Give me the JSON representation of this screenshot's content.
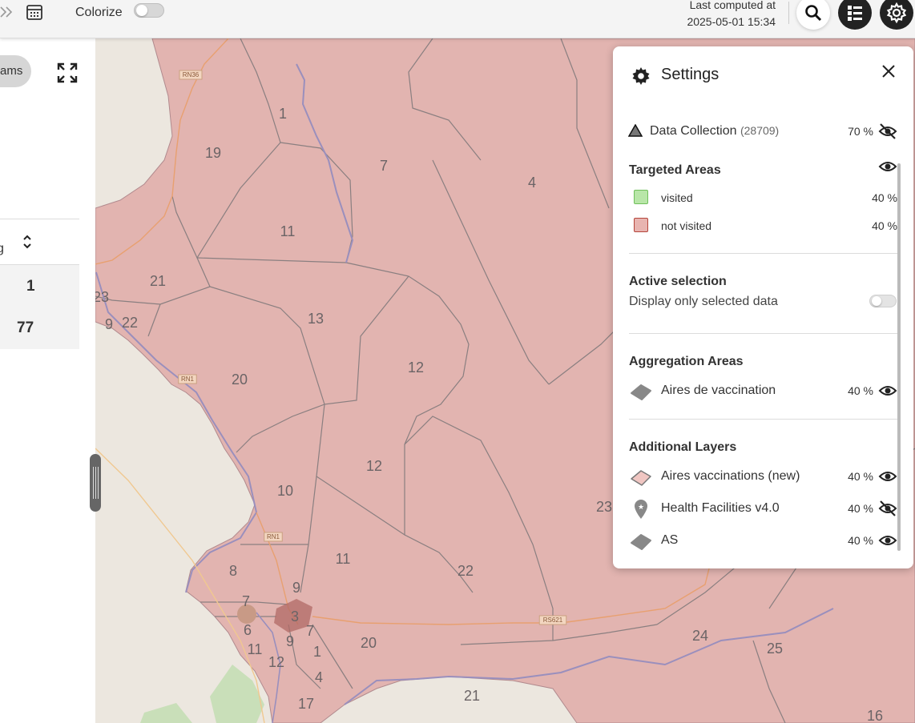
{
  "topbar": {
    "colorize_label": "Colorize",
    "colorize_on": false,
    "last_computed_label": "Last computed at",
    "last_computed_value": "2025-05-01 15:34",
    "icons": [
      "chevron-double-right-icon",
      "calendar-icon",
      "search-icon",
      "layers-list-icon",
      "gear-icon"
    ]
  },
  "left_panel": {
    "pill_label": "ams",
    "header_fragment": "g",
    "rows": [
      {
        "value": "1"
      },
      {
        "value": "77"
      }
    ]
  },
  "settings": {
    "title": "Settings",
    "data_collection": {
      "label": "Data Collection",
      "count": "(28709)",
      "opacity": "70 %",
      "visible": false
    },
    "targeted_areas": {
      "title": "Targeted Areas",
      "visible": true,
      "items": [
        {
          "label": "visited",
          "opacity": "40 %",
          "color": "#b8e6a8",
          "border": "#6fbf5b"
        },
        {
          "label": "not visited",
          "opacity": "40 %",
          "color": "#e8b4b0",
          "border": "#b5453b"
        }
      ]
    },
    "active_selection": {
      "title": "Active selection",
      "description": "Display only selected data",
      "enabled": false
    },
    "aggregation_areas": {
      "title": "Aggregation Areas",
      "items": [
        {
          "label": "Aires de vaccination",
          "opacity": "40 %",
          "visible": true
        }
      ]
    },
    "additional_layers": {
      "title": "Additional Layers",
      "items": [
        {
          "label": "Aires vaccinations (new)",
          "opacity": "40 %",
          "visible": true
        },
        {
          "label": "Health Facilities v4.0",
          "opacity": "40 %",
          "visible": false
        },
        {
          "label": "AS",
          "opacity": "40 %",
          "visible": true
        }
      ]
    }
  },
  "map": {
    "area_color": "#e2b4b0",
    "border_color": "#8a7f80",
    "river_color": "#9a8fbd",
    "road_color": "#e8a070",
    "area_labels": [
      "1",
      "19",
      "7",
      "4",
      "11",
      "21",
      "23",
      "9",
      "22",
      "13",
      "12",
      "20",
      "12",
      "10",
      "23",
      "11",
      "8",
      "9",
      "22",
      "7",
      "6",
      "11",
      "9",
      "1",
      "20",
      "24",
      "25",
      "12",
      "4",
      "21",
      "17",
      "16",
      "3",
      "7"
    ],
    "road_labels": [
      "RN36",
      "RN1",
      "RN1",
      "RS621"
    ]
  }
}
